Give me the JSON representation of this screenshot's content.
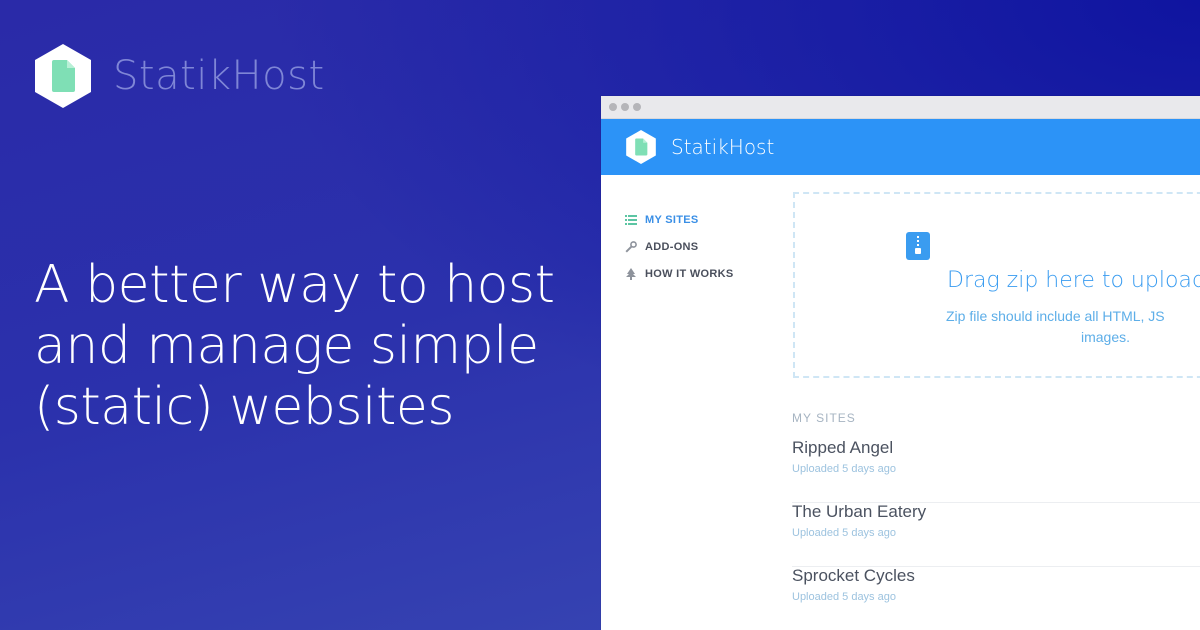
{
  "brand": {
    "name": "StatikHost"
  },
  "headline": {
    "line1": "A better way to host",
    "line2": "and manage simple",
    "line3": "(static) websites"
  },
  "app": {
    "title": "StatikHost",
    "sidebar": [
      {
        "label": "MY SITES",
        "icon": "list-icon",
        "active": true
      },
      {
        "label": "ADD-ONS",
        "icon": "wrench-icon",
        "active": false
      },
      {
        "label": "HOW IT WORKS",
        "icon": "tree-icon",
        "active": false
      }
    ],
    "upload": {
      "title": "Drag zip here to upload",
      "subtitle_line1": "Zip file should include all HTML, JS",
      "subtitle_line2": "images."
    },
    "sites_heading": "MY SITES",
    "sites": [
      {
        "name": "Ripped Angel",
        "meta": "Uploaded 5 days ago"
      },
      {
        "name": "The Urban Eatery",
        "meta": "Uploaded 5 days ago"
      },
      {
        "name": "Sprocket Cycles",
        "meta": "Uploaded 5 days ago"
      }
    ]
  },
  "colors": {
    "accent": "#2c93f7",
    "brand_green": "#7fdfb5",
    "bg": "#2b31ac"
  }
}
